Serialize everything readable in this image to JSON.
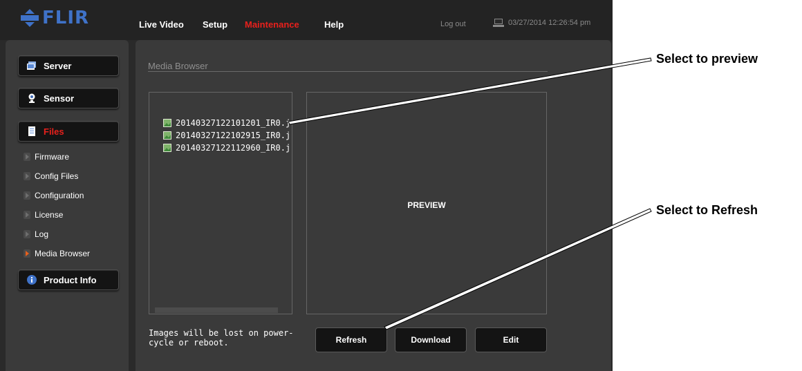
{
  "header": {
    "logo_text": "FLIR",
    "nav": [
      {
        "label": "Live Video"
      },
      {
        "label": "Setup"
      },
      {
        "label": "Maintenance",
        "active": true
      },
      {
        "label": "Help"
      }
    ],
    "logout_label": "Log out",
    "datetime": "03/27/2014 12:26:54 pm"
  },
  "sidebar": {
    "buttons": [
      {
        "label": "Server",
        "icon": "server-icon"
      },
      {
        "label": "Sensor",
        "icon": "sensor-icon"
      },
      {
        "label": "Files",
        "icon": "files-icon",
        "active": true
      },
      {
        "label": "Product Info",
        "icon": "info-icon"
      }
    ],
    "subitems": [
      {
        "label": "Firmware"
      },
      {
        "label": "Config Files"
      },
      {
        "label": "Configuration"
      },
      {
        "label": "License"
      },
      {
        "label": "Log"
      },
      {
        "label": "Media Browser",
        "active": true
      }
    ]
  },
  "main": {
    "section_title": "Media Browser",
    "files": [
      "20140327122101201_IR0.j",
      "20140327122102915_IR0.j",
      "20140327122112960_IR0.j"
    ],
    "preview_label": "PREVIEW",
    "note": "Images will be lost on power-cycle or reboot.",
    "buttons": {
      "refresh": "Refresh",
      "download": "Download",
      "edit": "Edit"
    }
  },
  "callouts": {
    "preview": "Select to preview",
    "refresh": "Select to Refresh"
  },
  "colors": {
    "accent_red": "#e8201c",
    "logo_blue": "#3f72c8",
    "panel_bg": "#3a3a3a",
    "app_bg": "#2a2a2a"
  }
}
